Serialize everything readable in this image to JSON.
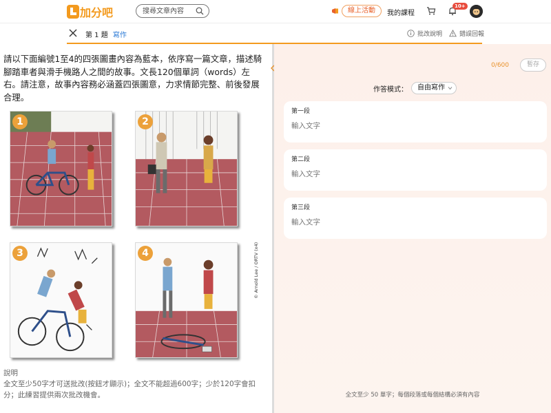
{
  "brand": {
    "name": "加分吧",
    "color": "#f39a1e"
  },
  "nav": {
    "search_placeholder": "搜尋文章內容",
    "promo_label": "線上活動",
    "my_courses": "我的課程",
    "notification_count": "10+"
  },
  "question": {
    "number_label": "第 1 題",
    "type_label": "寫作",
    "actions": [
      "批改說明",
      "錯誤回報"
    ]
  },
  "prompt_text": "請以下面編號1至4的四張圖畫內容為藍本，依序寫一篇文章，描述騎腳踏車者與滑手機路人之間的故事。文長120個單詞（words）左右。請注意，故事內容務必涵蓋四張圖意，力求情節完整、前後發展合理。",
  "panels": [
    "1",
    "2",
    "3",
    "4"
  ],
  "image_credit": "© Arnold Lee / ORTV (x4)",
  "explanation": {
    "title": "說明",
    "body": "全文至少50字才可送批改(按鈕才顯示)；全文不能超過600字；少於120字會扣分；此練習提供兩次批改機會。"
  },
  "editor": {
    "word_count": "0/600",
    "draft_button": "暫存",
    "mode_label": "作答模式：",
    "mode_value": "自由寫作",
    "paragraphs": [
      {
        "label": "第一段",
        "placeholder": "輸入文字"
      },
      {
        "label": "第二段",
        "placeholder": "輸入文字"
      },
      {
        "label": "第三段",
        "placeholder": "輸入文字"
      }
    ],
    "footer_note": "全文至少 50 單字；每個段落或每個結構必須有內容"
  }
}
